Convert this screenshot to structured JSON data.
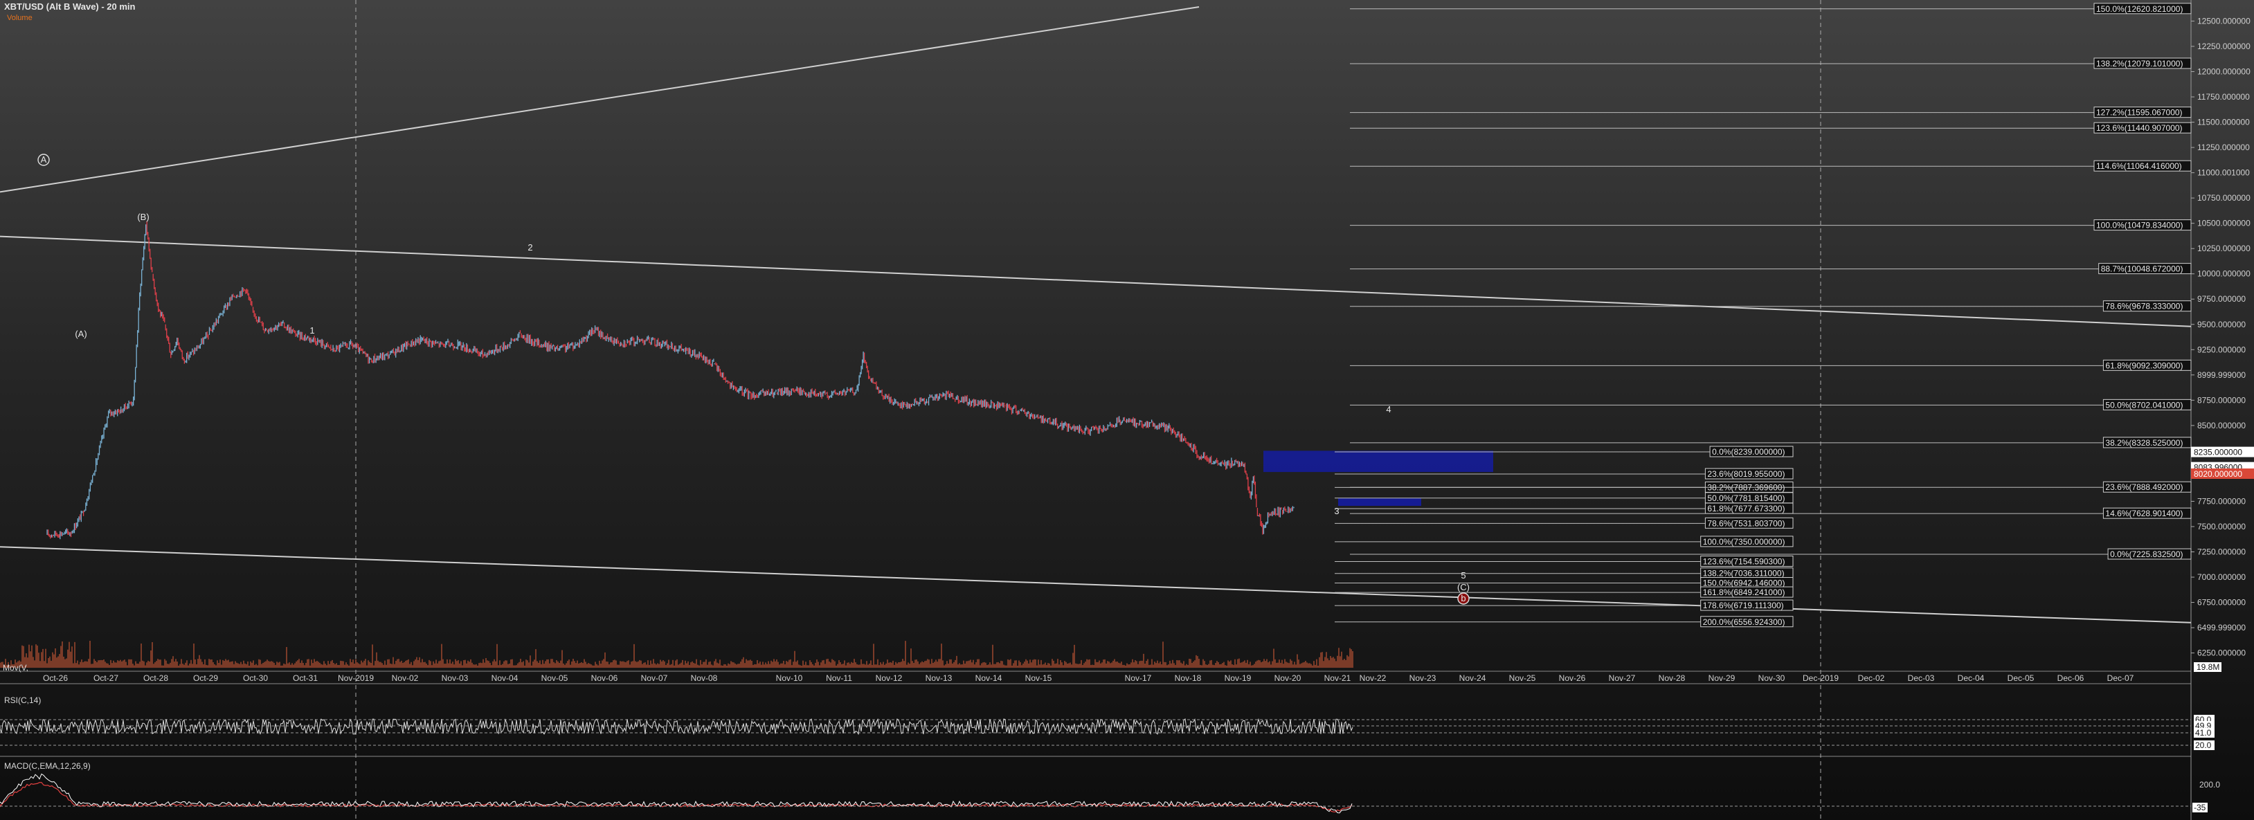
{
  "header": {
    "title": "XBT/USD (Alt B Wave) - 20 min",
    "subtitle": "Volume"
  },
  "panels": {
    "rsi_label": "RSI(C,14)",
    "macd_label": "MACD(C,EMA,12,26,9)",
    "vol_label": "Mov(V,",
    "rsi_ticks": [
      "60.0",
      "49.9",
      "41.0",
      "20.0"
    ],
    "macd_ticks": [
      "200.0",
      "-35"
    ]
  },
  "colors": {
    "up": "#7ab3d6",
    "down": "#e0404a",
    "volume": "#e0603a",
    "zone": "#141ca0",
    "fib_line": "#bdbdbd",
    "trend_line": "#d0d0d0",
    "price_box_red": "#d94838"
  },
  "chart_data": {
    "type": "candlestick",
    "title": "XBT/USD (Alt B Wave) - 20 min",
    "y_range": [
      6220,
      12640
    ],
    "x_labels": [
      "Oct-26",
      "Oct-27",
      "Oct-28",
      "Oct-29",
      "Oct-30",
      "Oct-31",
      "Nov-2019",
      "Nov-02",
      "Nov-03",
      "Nov-04",
      "Nov-05",
      "Nov-06",
      "Nov-07",
      "Nov-08",
      "Nov-10",
      "Nov-11",
      "Nov-12",
      "Nov-13",
      "Nov-14",
      "Nov-15",
      "Nov-17",
      "Nov-18",
      "Nov-19",
      "Nov-20",
      "Nov-21",
      "Nov-22",
      "Nov-23",
      "Nov-24",
      "Nov-25",
      "Nov-26",
      "Nov-27",
      "Nov-28",
      "Nov-29",
      "Nov-30",
      "Dec-2019",
      "Dec-02",
      "Dec-03",
      "Dec-04",
      "Dec-05",
      "Dec-06",
      "Dec-07"
    ],
    "y_ticks": [
      "12500.000000",
      "12250.000000",
      "12000.000000",
      "11750.000000",
      "11500.000000",
      "11250.000000",
      "11000.001000",
      "10750.000000",
      "10500.000000",
      "10250.000000",
      "10000.000000",
      "9750.000000",
      "9500.000000",
      "9250.000000",
      "8999.999000",
      "8750.000000",
      "8500.000000",
      "8250.000000",
      "8000.000000",
      "7750.000000",
      "7500.000000",
      "7250.000000",
      "7000.000000",
      "6750.000000",
      "6499.999000",
      "6250.000000"
    ],
    "price_boxes": [
      {
        "value": 8235,
        "text": "8235.000000",
        "style": "white"
      },
      {
        "value": 8083.996,
        "text": "8083.996000",
        "style": "white"
      },
      {
        "value": 8020,
        "text": "8020.000000",
        "style": "red"
      }
    ],
    "volume_box": "19.8M",
    "path": [
      [
        0,
        7420
      ],
      [
        8,
        7440
      ],
      [
        12,
        7650
      ],
      [
        16,
        8130
      ],
      [
        20,
        8620
      ],
      [
        24,
        8650
      ],
      [
        28,
        8750
      ],
      [
        30,
        9800
      ],
      [
        32,
        10500
      ],
      [
        34,
        10000
      ],
      [
        36,
        9650
      ],
      [
        38,
        9500
      ],
      [
        40,
        9200
      ],
      [
        42,
        9350
      ],
      [
        44,
        9150
      ],
      [
        48,
        9250
      ],
      [
        52,
        9400
      ],
      [
        56,
        9600
      ],
      [
        60,
        9780
      ],
      [
        64,
        9850
      ],
      [
        66,
        9650
      ],
      [
        70,
        9450
      ],
      [
        76,
        9500
      ],
      [
        80,
        9400
      ],
      [
        86,
        9350
      ],
      [
        92,
        9250
      ],
      [
        98,
        9300
      ],
      [
        104,
        9150
      ],
      [
        110,
        9200
      ],
      [
        116,
        9300
      ],
      [
        120,
        9350
      ],
      [
        126,
        9300
      ],
      [
        132,
        9300
      ],
      [
        140,
        9200
      ],
      [
        148,
        9300
      ],
      [
        152,
        9400
      ],
      [
        156,
        9330
      ],
      [
        164,
        9250
      ],
      [
        170,
        9300
      ],
      [
        176,
        9450
      ],
      [
        180,
        9350
      ],
      [
        186,
        9320
      ],
      [
        192,
        9350
      ],
      [
        198,
        9300
      ],
      [
        204,
        9250
      ],
      [
        208,
        9200
      ],
      [
        214,
        9110
      ],
      [
        220,
        8870
      ],
      [
        226,
        8800
      ],
      [
        234,
        8820
      ],
      [
        240,
        8850
      ],
      [
        248,
        8800
      ],
      [
        254,
        8820
      ],
      [
        260,
        8850
      ],
      [
        262,
        9200
      ],
      [
        264,
        8950
      ],
      [
        268,
        8800
      ],
      [
        272,
        8730
      ],
      [
        276,
        8700
      ],
      [
        284,
        8770
      ],
      [
        290,
        8800
      ],
      [
        296,
        8730
      ],
      [
        304,
        8700
      ],
      [
        312,
        8650
      ],
      [
        318,
        8580
      ],
      [
        326,
        8500
      ],
      [
        332,
        8450
      ],
      [
        340,
        8460
      ],
      [
        344,
        8540
      ],
      [
        352,
        8520
      ],
      [
        360,
        8480
      ],
      [
        370,
        8200
      ],
      [
        376,
        8110
      ],
      [
        380,
        8130
      ],
      [
        384,
        8130
      ],
      [
        386,
        7780
      ],
      [
        387,
        8000
      ],
      [
        388,
        7680
      ],
      [
        390,
        7450
      ],
      [
        392,
        7620
      ],
      [
        396,
        7650
      ],
      [
        400,
        7700
      ]
    ]
  },
  "fibonacci": {
    "left": [
      {
        "value": 8239.0,
        "text": "0.0%(8239.000000)"
      },
      {
        "value": 8019.955,
        "text": "23.6%(8019.955000)"
      },
      {
        "value": 7887.36966,
        "text": "38.2%(7887.369600)"
      },
      {
        "value": 7781.8154,
        "text": "50.0%(7781.815400)"
      },
      {
        "value": 7677.6733,
        "text": "61.8%(7677.673300)"
      },
      {
        "value": 7531.8037,
        "text": "78.6%(7531.803700)"
      },
      {
        "value": 7350.0,
        "text": "100.0%(7350.000000)"
      },
      {
        "value": 7154.5903,
        "text": "123.6%(7154.590300)"
      },
      {
        "value": 7036.3111,
        "text": "138.2%(7036.311000)"
      },
      {
        "value": 6942.146,
        "text": "150.0%(6942.146000)"
      },
      {
        "value": 6849.241,
        "text": "161.8%(6849.241000)"
      },
      {
        "value": 6719.1113,
        "text": "178.6%(6719.111300)"
      },
      {
        "value": 6556.9243,
        "text": "200.0%(6556.924300)"
      }
    ],
    "right": [
      {
        "value": 12620.821,
        "text": "150.0%(12620.821000)"
      },
      {
        "value": 12079.101,
        "text": "138.2%(12079.101000)"
      },
      {
        "value": 11595.067,
        "text": "127.2%(11595.067000)"
      },
      {
        "value": 11440.907,
        "text": "123.6%(11440.907000)"
      },
      {
        "value": 11064.416,
        "text": "114.6%(11064.416000)"
      },
      {
        "value": 10479.834,
        "text": "100.0%(10479.834000)"
      },
      {
        "value": 10048.672,
        "text": "88.7%(10048.672000)"
      },
      {
        "value": 9678.333,
        "text": "78.6%(9678.333000)"
      },
      {
        "value": 9092.309,
        "text": "61.8%(9092.309000)"
      },
      {
        "value": 8702.041,
        "text": "50.0%(8702.041000)"
      },
      {
        "value": 8328.525,
        "text": "38.2%(8328.525000)"
      },
      {
        "value": 7888.492,
        "text": "23.6%(7888.492000)"
      },
      {
        "value": 7628.9014,
        "text": "14.6%(7628.901400)"
      },
      {
        "value": 7225.8325,
        "text": "0.0%(7225.832500)"
      }
    ]
  },
  "wave_labels": {
    "A_circle": "A",
    "B_paren": "(B)",
    "A_paren": "(A)",
    "one": "1",
    "two": "2",
    "three": "3",
    "four": "4",
    "five": "5",
    "C_paren": "(C)",
    "b_circle": "b"
  }
}
